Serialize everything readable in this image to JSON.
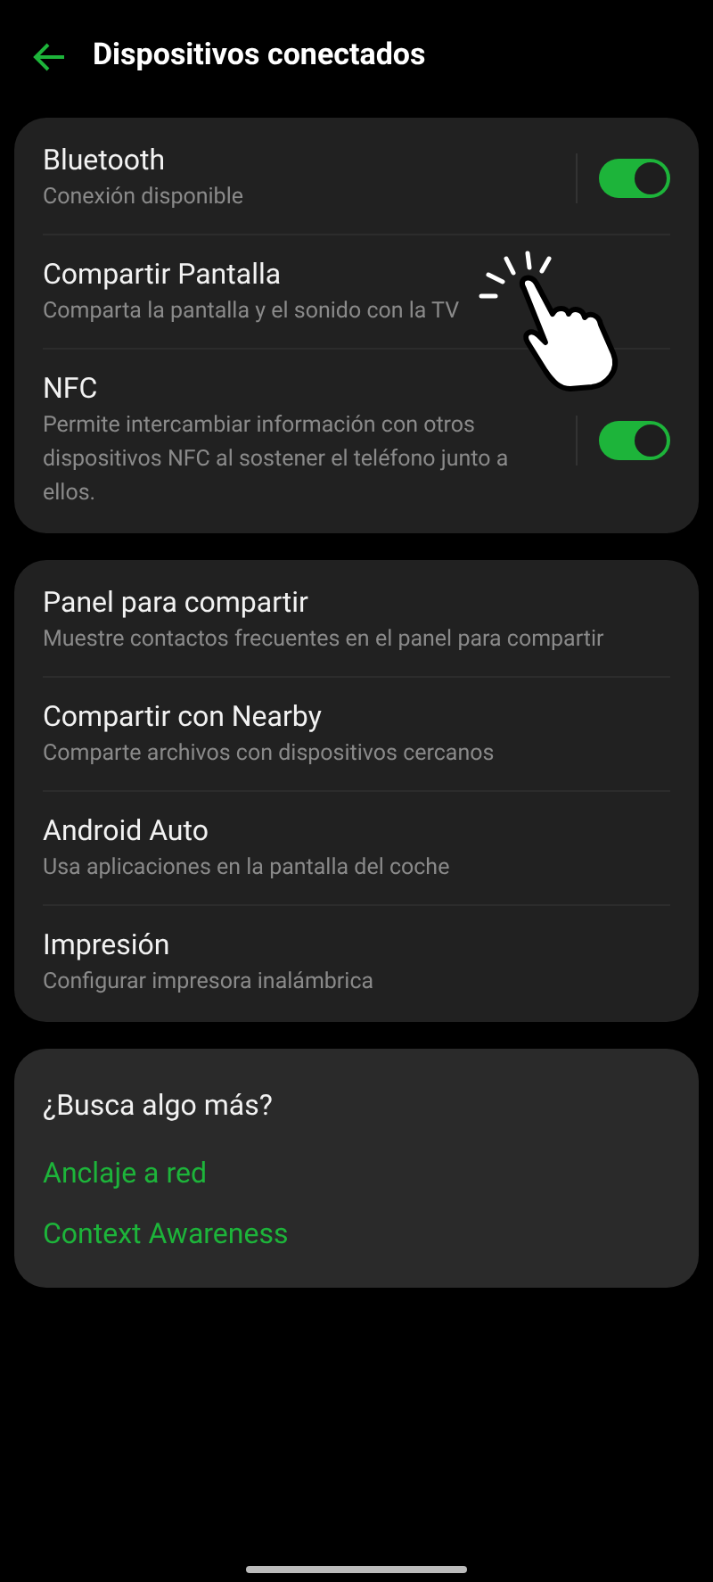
{
  "header": {
    "title": "Dispositivos conectados"
  },
  "groups": [
    {
      "items": [
        {
          "kind": "toggle",
          "title": "Bluetooth",
          "subtitle": "Conexión disponible",
          "on": true
        },
        {
          "kind": "plain",
          "title": "Compartir Pantalla",
          "subtitle": "Comparta la pantalla y el sonido con la TV"
        },
        {
          "kind": "toggle",
          "title": "NFC",
          "subtitle": "Permite intercambiar información con otros dispositivos NFC al sostener el teléfono junto a ellos.",
          "on": true
        }
      ]
    },
    {
      "items": [
        {
          "kind": "plain",
          "title": "Panel para compartir",
          "subtitle": "Muestre contactos frecuentes en el panel para compartir"
        },
        {
          "kind": "plain",
          "title": "Compartir con Nearby",
          "subtitle": "Comparte archivos con dispositivos cercanos"
        },
        {
          "kind": "plain",
          "title": "Android Auto",
          "subtitle": "Usa aplicaciones en la pantalla del coche"
        },
        {
          "kind": "plain",
          "title": "Impresión",
          "subtitle": "Configurar impresora inalámbrica"
        }
      ]
    }
  ],
  "more": {
    "title": "¿Busca algo más?",
    "links": [
      "Anclaje a red",
      "Context Awareness"
    ]
  }
}
